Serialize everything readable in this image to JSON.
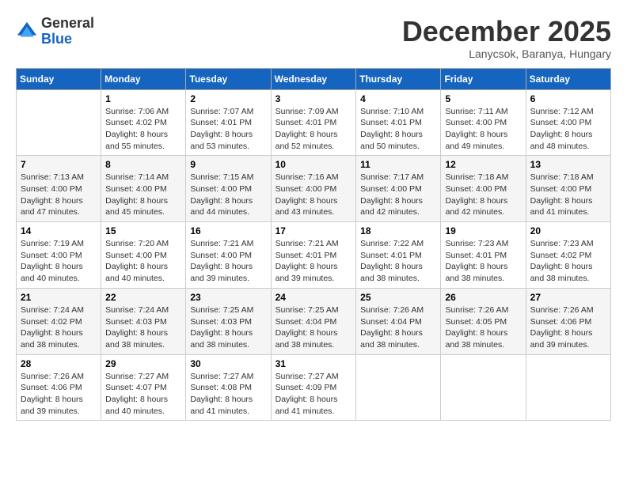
{
  "logo": {
    "general": "General",
    "blue": "Blue"
  },
  "header": {
    "month": "December 2025",
    "location": "Lanycsok, Baranya, Hungary"
  },
  "weekdays": [
    "Sunday",
    "Monday",
    "Tuesday",
    "Wednesday",
    "Thursday",
    "Friday",
    "Saturday"
  ],
  "weeks": [
    [
      {
        "day": "",
        "sunrise": "",
        "sunset": "",
        "daylight": ""
      },
      {
        "day": "1",
        "sunrise": "Sunrise: 7:06 AM",
        "sunset": "Sunset: 4:02 PM",
        "daylight": "Daylight: 8 hours and 55 minutes."
      },
      {
        "day": "2",
        "sunrise": "Sunrise: 7:07 AM",
        "sunset": "Sunset: 4:01 PM",
        "daylight": "Daylight: 8 hours and 53 minutes."
      },
      {
        "day": "3",
        "sunrise": "Sunrise: 7:09 AM",
        "sunset": "Sunset: 4:01 PM",
        "daylight": "Daylight: 8 hours and 52 minutes."
      },
      {
        "day": "4",
        "sunrise": "Sunrise: 7:10 AM",
        "sunset": "Sunset: 4:01 PM",
        "daylight": "Daylight: 8 hours and 50 minutes."
      },
      {
        "day": "5",
        "sunrise": "Sunrise: 7:11 AM",
        "sunset": "Sunset: 4:00 PM",
        "daylight": "Daylight: 8 hours and 49 minutes."
      },
      {
        "day": "6",
        "sunrise": "Sunrise: 7:12 AM",
        "sunset": "Sunset: 4:00 PM",
        "daylight": "Daylight: 8 hours and 48 minutes."
      }
    ],
    [
      {
        "day": "7",
        "sunrise": "Sunrise: 7:13 AM",
        "sunset": "Sunset: 4:00 PM",
        "daylight": "Daylight: 8 hours and 47 minutes."
      },
      {
        "day": "8",
        "sunrise": "Sunrise: 7:14 AM",
        "sunset": "Sunset: 4:00 PM",
        "daylight": "Daylight: 8 hours and 45 minutes."
      },
      {
        "day": "9",
        "sunrise": "Sunrise: 7:15 AM",
        "sunset": "Sunset: 4:00 PM",
        "daylight": "Daylight: 8 hours and 44 minutes."
      },
      {
        "day": "10",
        "sunrise": "Sunrise: 7:16 AM",
        "sunset": "Sunset: 4:00 PM",
        "daylight": "Daylight: 8 hours and 43 minutes."
      },
      {
        "day": "11",
        "sunrise": "Sunrise: 7:17 AM",
        "sunset": "Sunset: 4:00 PM",
        "daylight": "Daylight: 8 hours and 42 minutes."
      },
      {
        "day": "12",
        "sunrise": "Sunrise: 7:18 AM",
        "sunset": "Sunset: 4:00 PM",
        "daylight": "Daylight: 8 hours and 42 minutes."
      },
      {
        "day": "13",
        "sunrise": "Sunrise: 7:18 AM",
        "sunset": "Sunset: 4:00 PM",
        "daylight": "Daylight: 8 hours and 41 minutes."
      }
    ],
    [
      {
        "day": "14",
        "sunrise": "Sunrise: 7:19 AM",
        "sunset": "Sunset: 4:00 PM",
        "daylight": "Daylight: 8 hours and 40 minutes."
      },
      {
        "day": "15",
        "sunrise": "Sunrise: 7:20 AM",
        "sunset": "Sunset: 4:00 PM",
        "daylight": "Daylight: 8 hours and 40 minutes."
      },
      {
        "day": "16",
        "sunrise": "Sunrise: 7:21 AM",
        "sunset": "Sunset: 4:00 PM",
        "daylight": "Daylight: 8 hours and 39 minutes."
      },
      {
        "day": "17",
        "sunrise": "Sunrise: 7:21 AM",
        "sunset": "Sunset: 4:01 PM",
        "daylight": "Daylight: 8 hours and 39 minutes."
      },
      {
        "day": "18",
        "sunrise": "Sunrise: 7:22 AM",
        "sunset": "Sunset: 4:01 PM",
        "daylight": "Daylight: 8 hours and 38 minutes."
      },
      {
        "day": "19",
        "sunrise": "Sunrise: 7:23 AM",
        "sunset": "Sunset: 4:01 PM",
        "daylight": "Daylight: 8 hours and 38 minutes."
      },
      {
        "day": "20",
        "sunrise": "Sunrise: 7:23 AM",
        "sunset": "Sunset: 4:02 PM",
        "daylight": "Daylight: 8 hours and 38 minutes."
      }
    ],
    [
      {
        "day": "21",
        "sunrise": "Sunrise: 7:24 AM",
        "sunset": "Sunset: 4:02 PM",
        "daylight": "Daylight: 8 hours and 38 minutes."
      },
      {
        "day": "22",
        "sunrise": "Sunrise: 7:24 AM",
        "sunset": "Sunset: 4:03 PM",
        "daylight": "Daylight: 8 hours and 38 minutes."
      },
      {
        "day": "23",
        "sunrise": "Sunrise: 7:25 AM",
        "sunset": "Sunset: 4:03 PM",
        "daylight": "Daylight: 8 hours and 38 minutes."
      },
      {
        "day": "24",
        "sunrise": "Sunrise: 7:25 AM",
        "sunset": "Sunset: 4:04 PM",
        "daylight": "Daylight: 8 hours and 38 minutes."
      },
      {
        "day": "25",
        "sunrise": "Sunrise: 7:26 AM",
        "sunset": "Sunset: 4:04 PM",
        "daylight": "Daylight: 8 hours and 38 minutes."
      },
      {
        "day": "26",
        "sunrise": "Sunrise: 7:26 AM",
        "sunset": "Sunset: 4:05 PM",
        "daylight": "Daylight: 8 hours and 38 minutes."
      },
      {
        "day": "27",
        "sunrise": "Sunrise: 7:26 AM",
        "sunset": "Sunset: 4:06 PM",
        "daylight": "Daylight: 8 hours and 39 minutes."
      }
    ],
    [
      {
        "day": "28",
        "sunrise": "Sunrise: 7:26 AM",
        "sunset": "Sunset: 4:06 PM",
        "daylight": "Daylight: 8 hours and 39 minutes."
      },
      {
        "day": "29",
        "sunrise": "Sunrise: 7:27 AM",
        "sunset": "Sunset: 4:07 PM",
        "daylight": "Daylight: 8 hours and 40 minutes."
      },
      {
        "day": "30",
        "sunrise": "Sunrise: 7:27 AM",
        "sunset": "Sunset: 4:08 PM",
        "daylight": "Daylight: 8 hours and 41 minutes."
      },
      {
        "day": "31",
        "sunrise": "Sunrise: 7:27 AM",
        "sunset": "Sunset: 4:09 PM",
        "daylight": "Daylight: 8 hours and 41 minutes."
      },
      {
        "day": "",
        "sunrise": "",
        "sunset": "",
        "daylight": ""
      },
      {
        "day": "",
        "sunrise": "",
        "sunset": "",
        "daylight": ""
      },
      {
        "day": "",
        "sunrise": "",
        "sunset": "",
        "daylight": ""
      }
    ]
  ]
}
